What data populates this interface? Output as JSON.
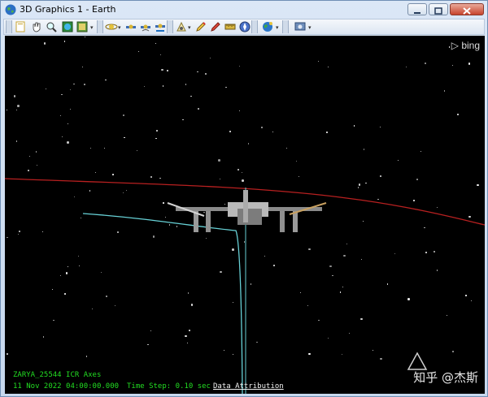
{
  "window": {
    "title": "3D Graphics 1 - Earth",
    "controls": [
      "minimize",
      "maximize",
      "close"
    ]
  },
  "toolbar": {
    "icons": [
      "new-scene-icon",
      "pan-hand-icon",
      "zoom-icon",
      "globe-view-icon",
      "map-view-icon",
      "orbit-view-icon",
      "satellite-a-icon",
      "satellite-b-icon",
      "satellite-c-icon",
      "sensor-icon",
      "pencil-red-icon",
      "pencil-marker-icon",
      "ruler-icon",
      "compass-icon",
      "earth-globe-icon",
      "render-settings-icon"
    ]
  },
  "viewport": {
    "bing_label": "bing",
    "object_label": "ZARYA_25544 ICR Axes",
    "date_time": "11 Nov 2022 04:00:00.000",
    "time_step": "Time Step: 0.10 sec",
    "attribution": "Data Attribution",
    "watermark": "知乎 @杰斯"
  },
  "colors": {
    "orbit_line": "#b82020",
    "ground_track": "#67d1d6",
    "overlay_text": "#22dd22",
    "attribution_text": "#f2f2f2"
  }
}
